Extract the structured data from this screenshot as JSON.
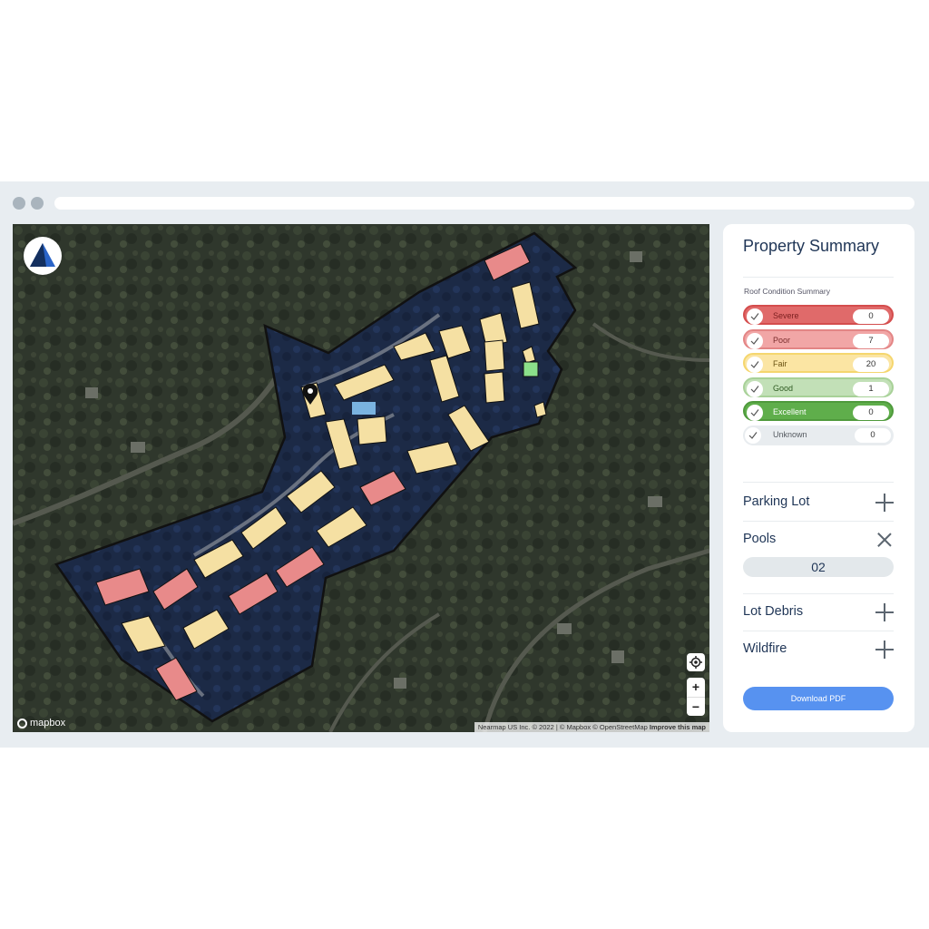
{
  "browser": {
    "colors": {
      "chrome": "#e8edf1",
      "dots": "#a9b4bd"
    }
  },
  "map": {
    "brand_logo": "lot-detection-logo-icon",
    "mapbox_label": "mapbox",
    "attribution": "Nearmap US Inc. © 2022 | © Mapbox © OpenStreetMap",
    "attribution_link": "Improve this map",
    "controls": {
      "locate_icon": "crosshair-icon",
      "zoom_in": "+",
      "zoom_out": "−"
    },
    "marker_icon": "map-pin-icon",
    "colors": {
      "outline": "#111111",
      "parcel_fill": "#1b2a4a",
      "roof_fair": "#f5e0a3",
      "roof_poor": "#e88a8a",
      "roof_good": "#8be08a"
    }
  },
  "panel": {
    "title": "Property Summary",
    "roof_summary_title": "Roof Condition Summary",
    "conditions": [
      {
        "label": "Severe",
        "count": "0",
        "fill": "#e06a6a",
        "border": "#d44d4d",
        "text": "#7a1f1f"
      },
      {
        "label": "Poor",
        "count": "7",
        "fill": "#f1a6a6",
        "border": "#e38585",
        "text": "#7a2e2e"
      },
      {
        "label": "Fair",
        "count": "20",
        "fill": "#fbe5a3",
        "border": "#f5d66e",
        "text": "#6b5313"
      },
      {
        "label": "Good",
        "count": "1",
        "fill": "#c2e0b7",
        "border": "#a8d198",
        "text": "#2f5a22"
      },
      {
        "label": "Excellent",
        "count": "0",
        "fill": "#5fae4b",
        "border": "#4f9a3c",
        "text": "#ffffff"
      },
      {
        "label": "Unknown",
        "count": "0",
        "fill": "#e8ecef",
        "border": "#e8ecef",
        "text": "#555a60"
      }
    ],
    "sections": {
      "parking_lot": "Parking Lot",
      "pools": "Pools",
      "pools_count": "02",
      "lot_debris": "Lot Debris",
      "wildfire": "Wildfire"
    },
    "download_label": "Download PDF",
    "colors": {
      "accent": "#5792f0",
      "title": "#1f3556"
    }
  }
}
